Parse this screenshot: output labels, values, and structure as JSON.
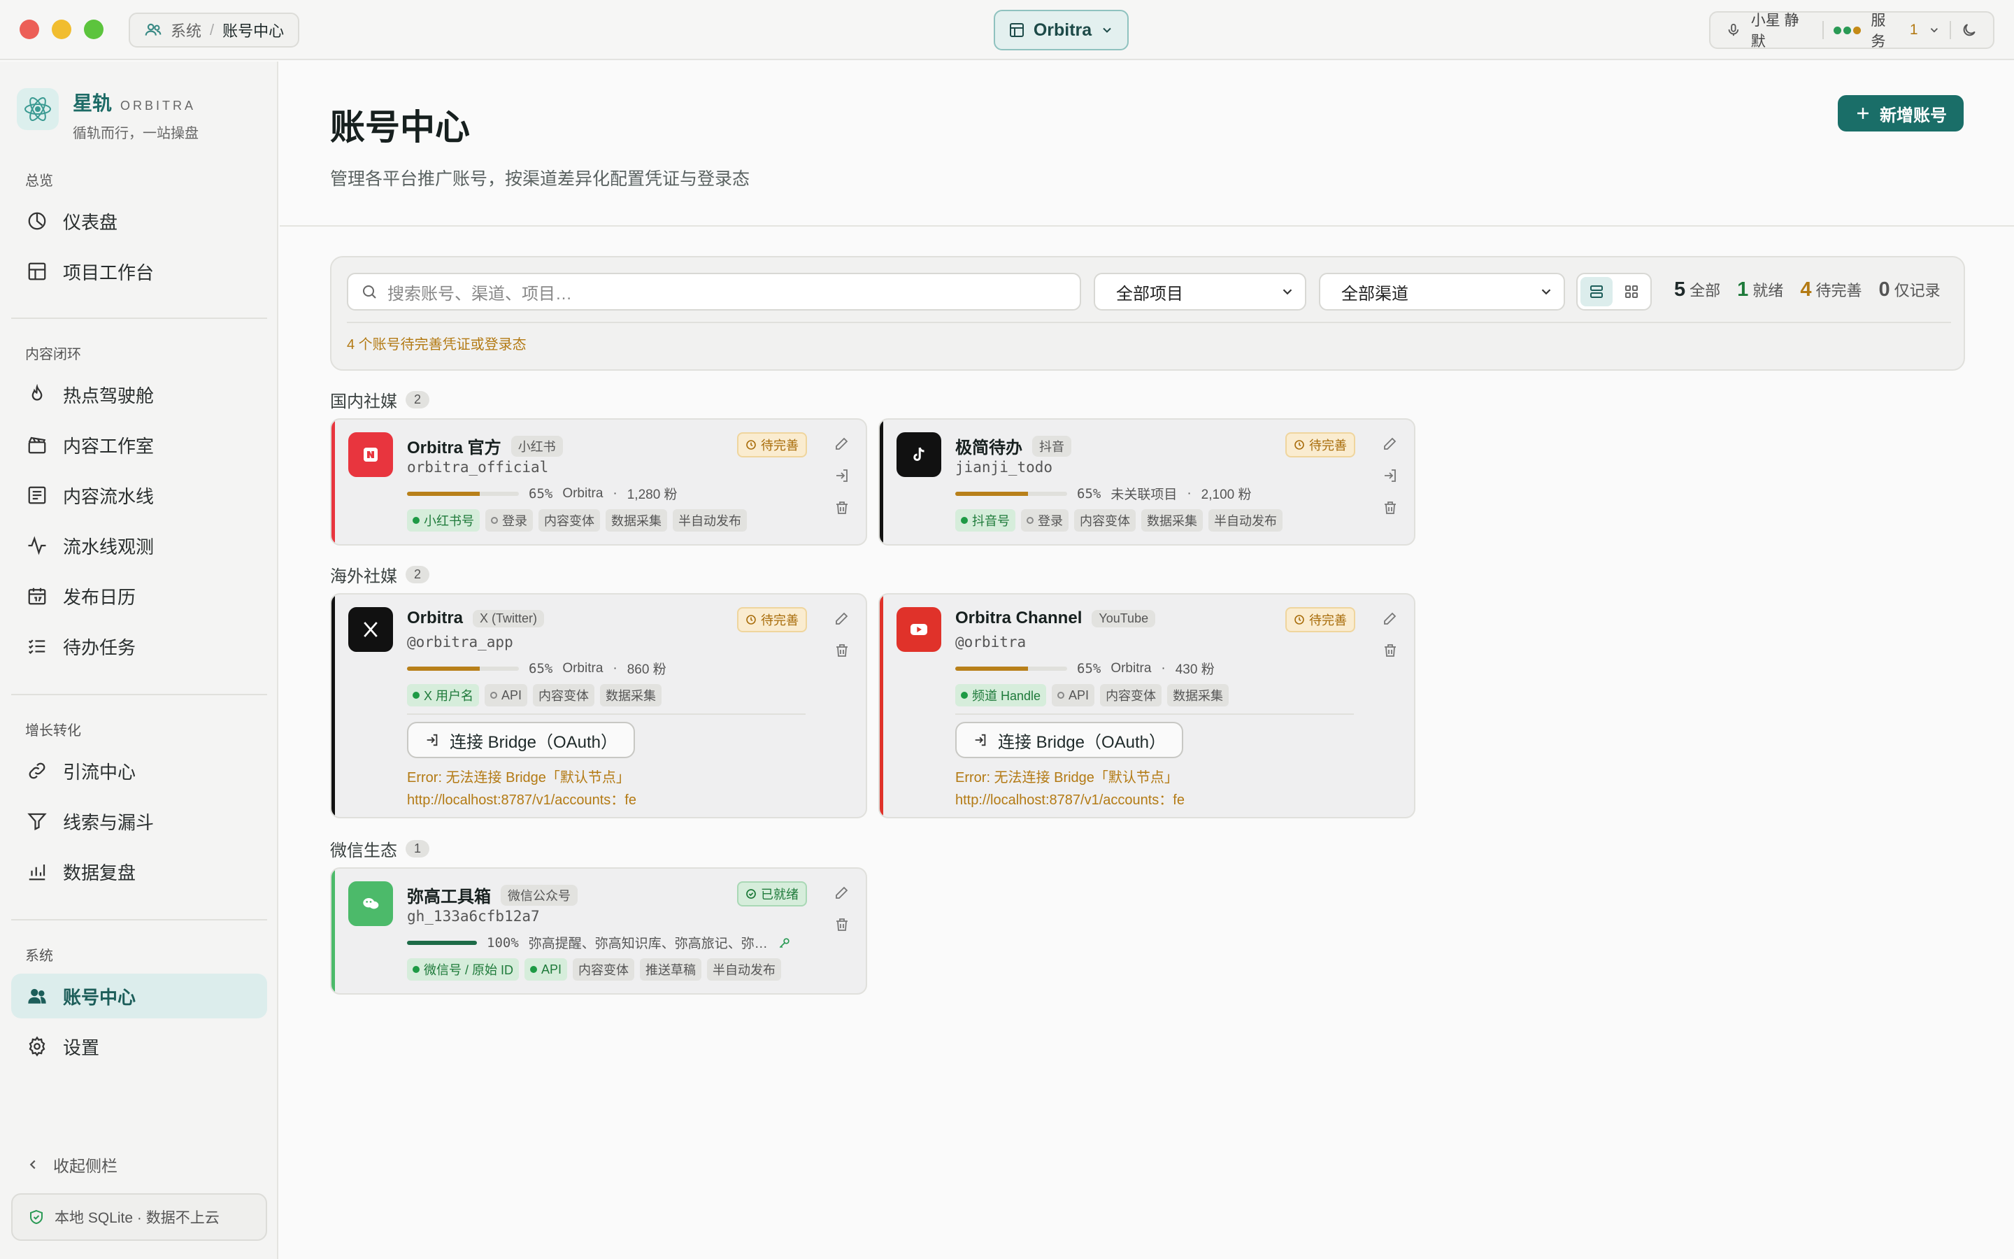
{
  "titlebar": {
    "breadcrumb": {
      "parent": "系统",
      "separator": "/",
      "current": "账号中心"
    },
    "project": "Orbitra",
    "mic_label": "小星 静默",
    "service_label": "服务",
    "service_count": "1"
  },
  "brand": {
    "name": "星轨",
    "name_en": "ORBITRA",
    "tagline": "循轨而行，一站操盘"
  },
  "nav": {
    "sections": {
      "overview": "总览",
      "content": "内容闭环",
      "growth": "增长转化",
      "system": "系统"
    },
    "items": [
      {
        "label": "仪表盘",
        "icon": "gauge-icon"
      },
      {
        "label": "项目工作台",
        "icon": "layout-icon"
      },
      {
        "label": "热点驾驶舱",
        "icon": "flame-icon"
      },
      {
        "label": "内容工作室",
        "icon": "clapper-icon"
      },
      {
        "label": "内容流水线",
        "icon": "list-icon"
      },
      {
        "label": "流水线观测",
        "icon": "activity-icon"
      },
      {
        "label": "发布日历",
        "icon": "calendar-icon"
      },
      {
        "label": "待办任务",
        "icon": "checklist-icon"
      },
      {
        "label": "引流中心",
        "icon": "link-icon"
      },
      {
        "label": "线索与漏斗",
        "icon": "funnel-icon"
      },
      {
        "label": "数据复盘",
        "icon": "bar-chart-icon"
      },
      {
        "label": "账号中心",
        "icon": "users-icon"
      },
      {
        "label": "设置",
        "icon": "gear-icon"
      }
    ],
    "collapse": "收起侧栏",
    "storage": "本地 SQLite · 数据不上云"
  },
  "page": {
    "title": "账号中心",
    "description": "管理各平台推广账号，按渠道差异化配置凭证与登录态",
    "new_button": "新增账号"
  },
  "filters": {
    "search_placeholder": "搜索账号、渠道、项目…",
    "project_select": "全部项目",
    "channel_select": "全部渠道",
    "counts": {
      "all": {
        "n": "5",
        "label": "全部"
      },
      "ready": {
        "n": "1",
        "label": "就绪"
      },
      "pending": {
        "n": "4",
        "label": "待完善"
      },
      "record": {
        "n": "0",
        "label": "仅记录"
      }
    },
    "note": "4 个账号待完善凭证或登录态"
  },
  "groups": [
    {
      "title": "国内社媒",
      "count": "2"
    },
    {
      "title": "海外社媒",
      "count": "2"
    },
    {
      "title": "微信生态",
      "count": "1"
    }
  ],
  "accounts": [
    {
      "name": "Orbitra 官方",
      "platform": "小红书",
      "handle": "orbitra_official",
      "progress": 65,
      "progress_label": "65%",
      "project": "Orbitra",
      "followers": "1,280 粉",
      "status": "待完善",
      "chips": [
        {
          "label": "小红书号",
          "ok": true
        },
        {
          "label": "登录",
          "ok": false
        },
        {
          "label": "内容变体"
        },
        {
          "label": "数据采集"
        },
        {
          "label": "半自动发布"
        }
      ],
      "accent": "#e8353e"
    },
    {
      "name": "极简待办",
      "platform": "抖音",
      "handle": "jianji_todo",
      "progress": 65,
      "progress_label": "65%",
      "project": "未关联项目",
      "followers": "2,100 粉",
      "status": "待完善",
      "chips": [
        {
          "label": "抖音号",
          "ok": true
        },
        {
          "label": "登录",
          "ok": false
        },
        {
          "label": "内容变体"
        },
        {
          "label": "数据采集"
        },
        {
          "label": "半自动发布"
        }
      ],
      "accent": "#111111"
    },
    {
      "name": "Orbitra",
      "platform": "X (Twitter)",
      "handle": "@orbitra_app",
      "progress": 65,
      "progress_label": "65%",
      "project": "Orbitra",
      "followers": "860 粉",
      "status": "待完善",
      "chips": [
        {
          "label": "X 用户名",
          "ok": true
        },
        {
          "label": "API",
          "ok": false
        },
        {
          "label": "内容变体"
        },
        {
          "label": "数据采集"
        }
      ],
      "connect": "连接 Bridge（OAuth）",
      "error_line1": "Error: 无法连接 Bridge「默认节点」",
      "error_line2": "http://localhost:8787/v1/accounts：fe",
      "accent": "#111111"
    },
    {
      "name": "Orbitra Channel",
      "platform": "YouTube",
      "handle": "@orbitra",
      "progress": 65,
      "progress_label": "65%",
      "project": "Orbitra",
      "followers": "430 粉",
      "status": "待完善",
      "chips": [
        {
          "label": "频道 Handle",
          "ok": true
        },
        {
          "label": "API",
          "ok": false
        },
        {
          "label": "内容变体"
        },
        {
          "label": "数据采集"
        }
      ],
      "connect": "连接 Bridge（OAuth）",
      "error_line1": "Error: 无法连接 Bridge「默认节点」",
      "error_line2": "http://localhost:8787/v1/accounts：fe",
      "accent": "#e0322a"
    },
    {
      "name": "弥高工具箱",
      "platform": "微信公众号",
      "handle": "gh_133a6cfb12a7",
      "progress": 100,
      "progress_label": "100%",
      "project": "弥高提醒、弥高知识库、弥高旅记、弥…",
      "status": "已就绪",
      "chips": [
        {
          "label": "微信号 / 原始 ID",
          "ok": true
        },
        {
          "label": "API",
          "ok": true
        },
        {
          "label": "内容变体"
        },
        {
          "label": "推送草稿"
        },
        {
          "label": "半自动发布"
        }
      ],
      "accent": "#4cba6a"
    }
  ],
  "colors": {
    "primary": "#1a6e68",
    "warning": "#b37a14",
    "ready": "#1e7a3a",
    "progress_partial": "#b8801a",
    "progress_full": "#1d6b48"
  }
}
